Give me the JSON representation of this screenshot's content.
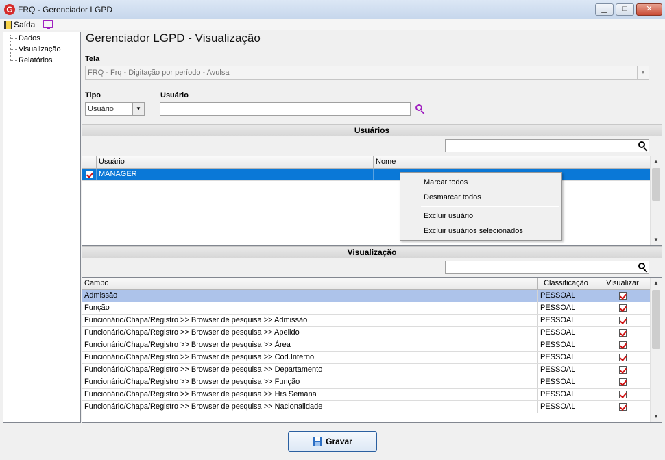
{
  "window": {
    "title": "FRQ - Gerenciador LGPD",
    "app_icon": "G",
    "minimize": "▁",
    "maximize": "□",
    "close": "✕"
  },
  "menubar": {
    "exit_label": "Saída",
    "exit_icon": "exit-door-icon",
    "monitor_icon": "monitor-icon"
  },
  "sidebar": {
    "items": [
      "Dados",
      "Visualização",
      "Relatórios"
    ]
  },
  "page": {
    "title": "Gerenciador LGPD - Visualização",
    "tela_label": "Tela",
    "tela_value": "FRQ - Frq - Digitação por período - Avulsa",
    "tipo_label": "Tipo",
    "tipo_value": "Usuário",
    "usuario_label": "Usuário",
    "usuario_value": ""
  },
  "usuarios_section": {
    "title": "Usuários",
    "search_value": "",
    "columns": [
      "Usuário",
      "Nome"
    ],
    "rows": [
      {
        "checked": true,
        "usuario": "MANAGER",
        "nome": ""
      }
    ]
  },
  "context_menu": {
    "items": [
      "Marcar todos",
      "Desmarcar todos",
      "Excluir usuário",
      "Excluir usuários selecionados"
    ]
  },
  "visualizacao_section": {
    "title": "Visualização",
    "search_value": "",
    "columns": [
      "Campo",
      "Classificação",
      "Visualizar"
    ],
    "rows": [
      {
        "campo": "Admissão",
        "classificacao": "PESSOAL",
        "visualizar": true
      },
      {
        "campo": "Função",
        "classificacao": "PESSOAL",
        "visualizar": true
      },
      {
        "campo": "Funcionário/Chapa/Registro >> Browser de pesquisa >> Admissão",
        "classificacao": "PESSOAL",
        "visualizar": true
      },
      {
        "campo": "Funcionário/Chapa/Registro >> Browser de pesquisa >> Apelido",
        "classificacao": "PESSOAL",
        "visualizar": true
      },
      {
        "campo": "Funcionário/Chapa/Registro >> Browser de pesquisa >> Área",
        "classificacao": "PESSOAL",
        "visualizar": true
      },
      {
        "campo": "Funcionário/Chapa/Registro >> Browser de pesquisa >> Cód.Interno",
        "classificacao": "PESSOAL",
        "visualizar": true
      },
      {
        "campo": "Funcionário/Chapa/Registro >> Browser de pesquisa >> Departamento",
        "classificacao": "PESSOAL",
        "visualizar": true
      },
      {
        "campo": "Funcionário/Chapa/Registro >> Browser de pesquisa >> Função",
        "classificacao": "PESSOAL",
        "visualizar": true
      },
      {
        "campo": "Funcionário/Chapa/Registro >> Browser de pesquisa >> Hrs Semana",
        "classificacao": "PESSOAL",
        "visualizar": true
      },
      {
        "campo": "Funcionário/Chapa/Registro >> Browser de pesquisa >> Nacionalidade",
        "classificacao": "PESSOAL",
        "visualizar": true
      }
    ]
  },
  "footer": {
    "save_label": "Gravar"
  },
  "colors": {
    "selection": "#0a78d7",
    "highlight_row": "#adc3ea",
    "check_mark": "#d01010",
    "search_accent": "#a020c0"
  }
}
